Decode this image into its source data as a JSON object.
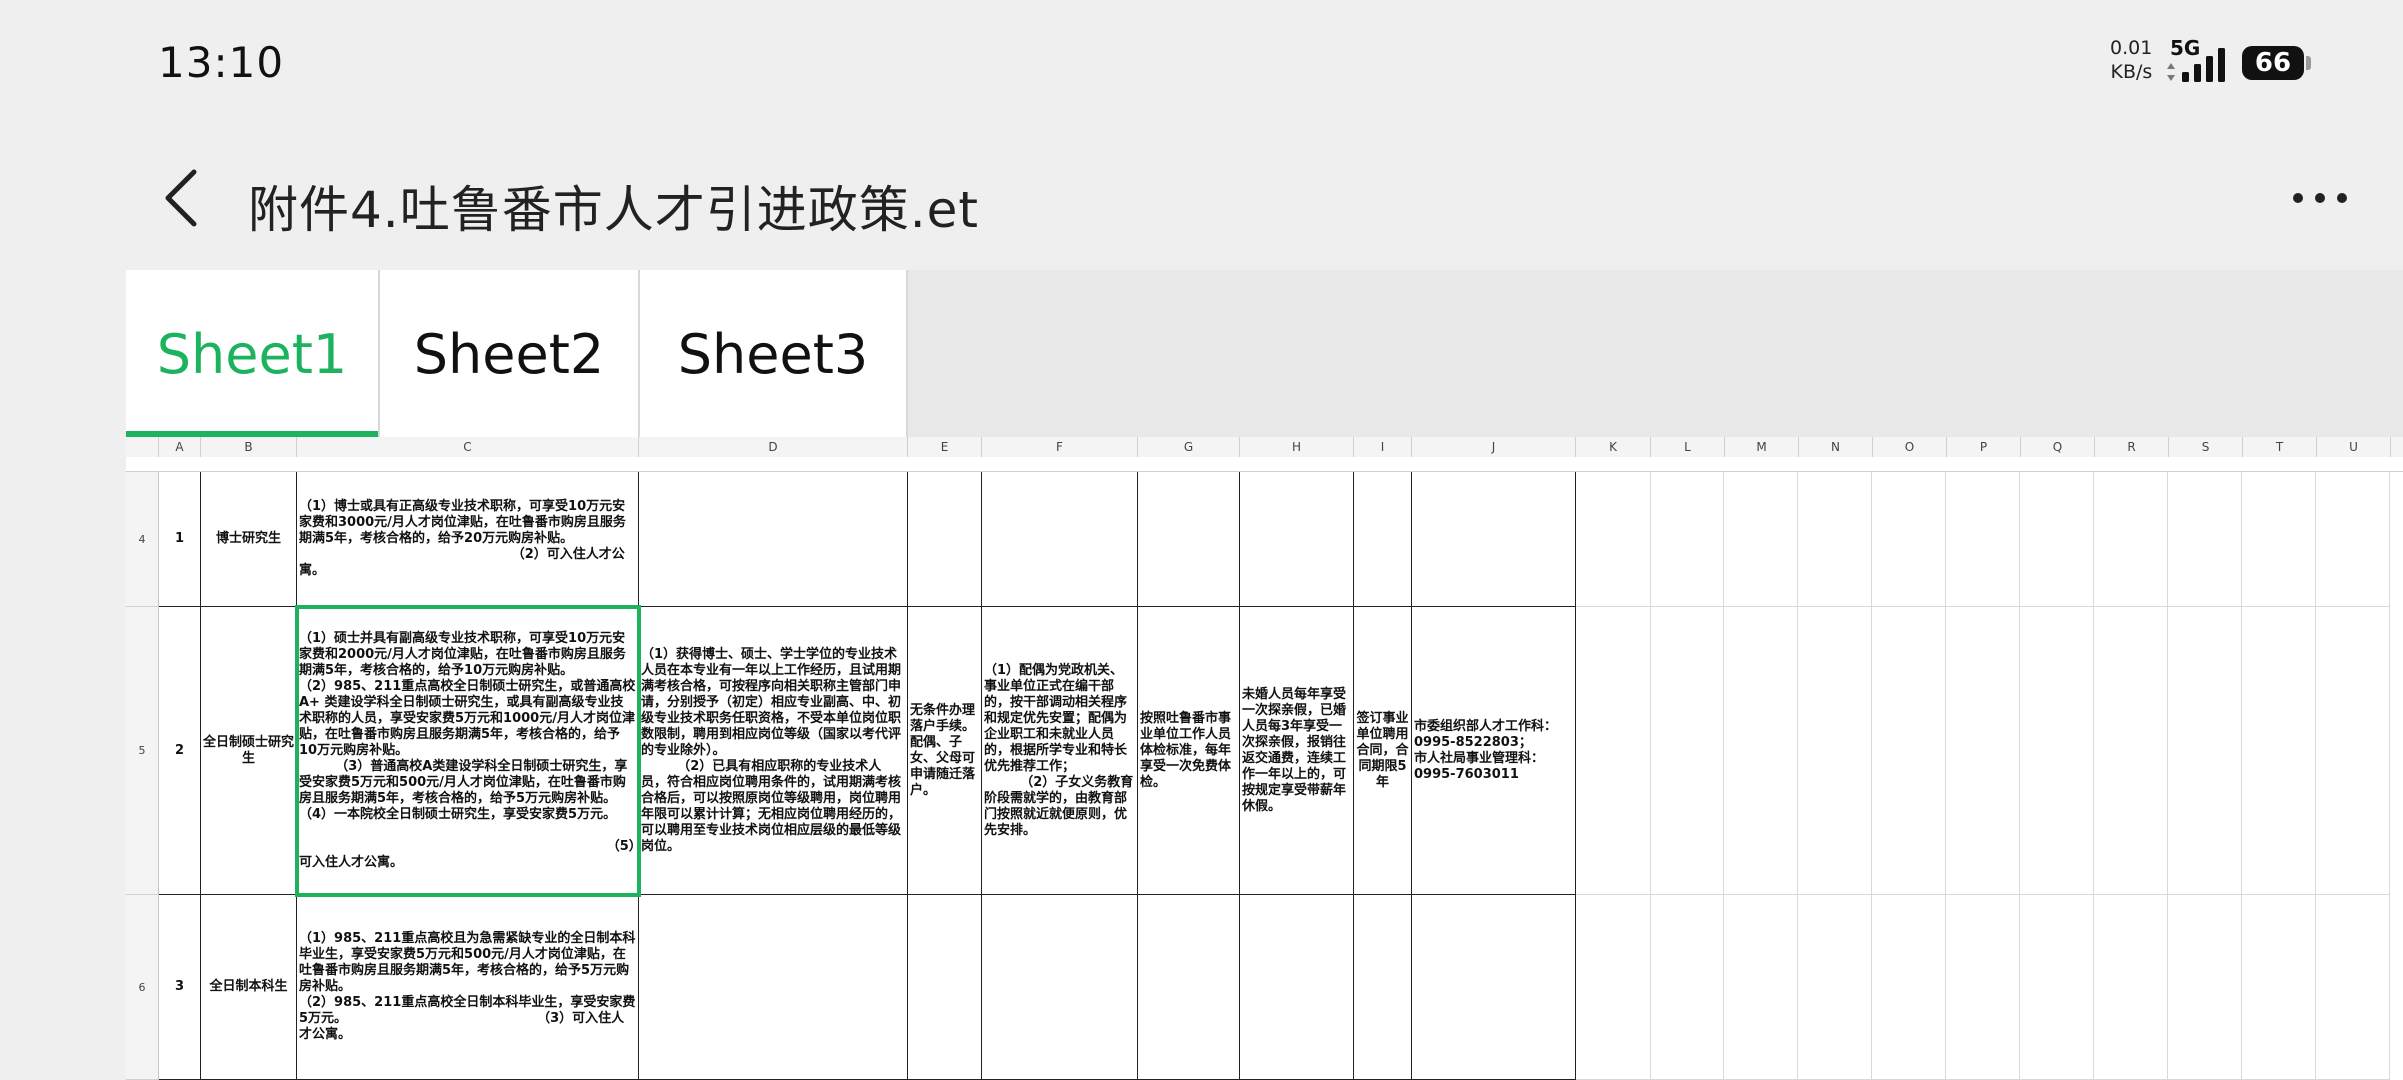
{
  "status_bar": {
    "time": "13:10",
    "net_rate_value": "0.01",
    "net_rate_unit": "KB/s",
    "network_type": "5G",
    "battery_percent": "66"
  },
  "title_bar": {
    "file_name": "附件4.吐鲁番市人才引进政策.et",
    "back_icon": "back-arrow-icon",
    "more_icon": "more-dots-icon"
  },
  "tabs": [
    {
      "label": "Sheet1",
      "active": true
    },
    {
      "label": "Sheet2",
      "active": false
    },
    {
      "label": "Sheet3",
      "active": false
    }
  ],
  "columns": [
    "A",
    "B",
    "C",
    "D",
    "E",
    "F",
    "G",
    "H",
    "I",
    "J",
    "K",
    "L",
    "M",
    "N",
    "O",
    "P",
    "Q",
    "R",
    "S",
    "T",
    "U"
  ],
  "rows": [
    {
      "row_number": "4",
      "A": "1",
      "B": "博士研究生",
      "C": "（1）博士或具有正高级专业技术职称，可享受10万元安家费和3000元/月人才岗位津贴，在吐鲁番市购房且服务期满5年，考核合格的，给予20万元购房补贴。\n                                               （2）可入住人才公寓。",
      "D": "",
      "E": "",
      "F": "",
      "G": "",
      "H": "",
      "I": "",
      "J": ""
    },
    {
      "row_number": "5",
      "A": "2",
      "B": "全日制硕士研究生",
      "C": "（1）硕士并具有副高级专业技术职称，可享受10万元安家费和2000元/月人才岗位津贴，在吐鲁番市购房且服务期满5年，考核合格的，给予10万元购房补贴。\n（2）985、211重点高校全日制硕士研究生，或普通高校A+ 类建设学科全日制硕士研究生，或具有副高级专业技术职称的人员，享受安家费5万元和1000元/月人才岗位津贴，在吐鲁番市购房且服务期满5年，考核合格的，给予10万元购房补贴。\n        （3）普通高校A类建设学科全日制硕士研究生，享受安家费5万元和500元/月人才岗位津贴，在吐鲁番市购房且服务期满5年，考核合格的，给予5万元购房补贴。                                          （4）一本院校全日制硕士研究生，享受安家费5万元。\n\n                                                                    （5）可入住人才公寓。",
      "D": "（1）获得博士、硕士、学士学位的专业技术人员在本专业有一年以上工作经历，且试用期满考核合格，可按程序向相关职称主管部门申请，分别授予（初定）相应专业副高、中、初级专业技术职务任职资格，不受本单位岗位职数限制，聘用到相应岗位等级（国家以考代评的专业除外）。\n        （2）已具有相应职称的专业技术人员，符合相应岗位聘用条件的，试用期满考核合格后，可以按照原岗位等级聘用，岗位聘用年限可以累计计算；无相应岗位聘用经历的，可以聘用至专业技术岗位相应层级的最低等级岗位。",
      "E": "无条件办理落户手续。配偶、子女、父母可申请随迁落户。",
      "F": "（1）配偶为党政机关、事业单位正式在编干部的，按干部调动相关程序和规定优先安置；配偶为企业职工和未就业人员的，根据所学专业和特长优先推荐工作；\n        （2）子女义务教育阶段需就学的，由教育部门按照就近就便原则，优先安排。",
      "G": "按照吐鲁番市事业单位工作人员体检标准，每年享受一次免费体检。",
      "H": "未婚人员每年享受一次探亲假，已婚人员每3年享受一次探亲假，报销往返交通费，连续工作一年以上的，可按规定享受带薪年休假。",
      "I": "签订事业单位聘用合同，合同期限5年",
      "J": "市委组织部人才工作科：0995-8522803；\n市人社局事业管理科：0995-7603011"
    },
    {
      "row_number": "6",
      "A": "3",
      "B": "全日制本科生",
      "C": "（1）985、211重点高校且为急需紧缺专业的全日制本科毕业生，享受安家费5万元和500元/月人才岗位津贴，在吐鲁番市购房且服务期满5年，考核合格的，给予5万元购房补贴。\n（2）985、211重点高校全日制本科毕业生，享受安家费5万元。                                          （3）可入住人才公寓。",
      "D": "",
      "E": "",
      "F": "",
      "G": "",
      "H": "",
      "I": "",
      "J": ""
    }
  ]
}
